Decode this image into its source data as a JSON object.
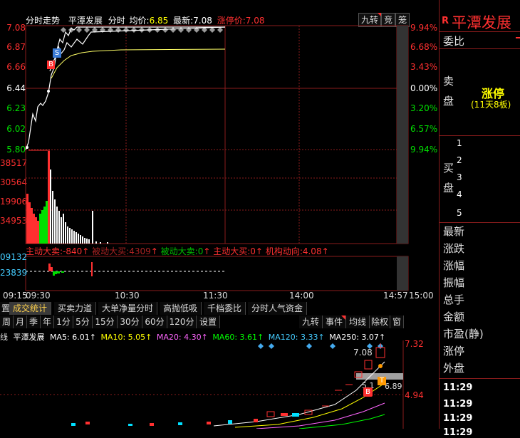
{
  "header": {
    "tab_label": "分时走势",
    "stock_name": "平潭发展",
    "period": "分时",
    "avg_label": "均价:",
    "avg_value": "6.85",
    "last_label": "最新:",
    "last_value": "7.08",
    "limit_label": "涨停价:",
    "limit_value": "7.08",
    "btn_jiuzhuan": "九转",
    "btn_jing": "竞",
    "btn_long": "笼"
  },
  "price_axis_left": [
    "7.08",
    "6.87",
    "6.66",
    "6.44",
    "6.23",
    "6.02",
    "5.80"
  ],
  "price_axis_right": [
    "9.94%",
    "6.68%",
    "3.43%",
    "0.00%",
    "3.20%",
    "6.57%",
    "9.94%"
  ],
  "volume_axis": [
    "38517",
    "30564",
    "19906",
    "34953"
  ],
  "flow": {
    "main_sell_label": "主动大卖:",
    "main_sell_value": "-840",
    "passive_buy_label": "被动大买:",
    "passive_buy_value": "4309",
    "passive_sell_label": "被动大卖:",
    "passive_sell_value": "0",
    "main_buy_label": "主动大买:",
    "main_buy_value": "0",
    "inst_label": "机构动向:",
    "inst_value": "4.08",
    "axis": [
      "09132",
      "23839"
    ]
  },
  "time_axis": [
    "09:15",
    "09:30",
    "10:30",
    "11:30",
    "14:00",
    "14:57",
    "15:00"
  ],
  "markers": {
    "s": "S",
    "b": "B",
    "b2": "B",
    "t": "T"
  },
  "bottom_tabs": [
    "置",
    "成交统计",
    "买卖力道",
    "大单净量分时",
    "高抛低吸",
    "千档委比",
    "分时人气资金"
  ],
  "period_tabs": [
    "周",
    "月",
    "季",
    "年",
    "1分",
    "5分",
    "15分",
    "30分",
    "60分",
    "120分",
    "设置",
    "九转",
    "事件",
    "均线",
    "除权",
    "窗"
  ],
  "ma_line": {
    "prefix": "线",
    "name": "平潭发展",
    "items": [
      {
        "label": "MA5: 6.01↑",
        "color": "#ffffff"
      },
      {
        "label": "MA10: 5.05↑",
        "color": "#ffff00"
      },
      {
        "label": "MA20: 4.30↑",
        "color": "#ff66ff"
      },
      {
        "label": "MA60: 3.61↑",
        "color": "#00ff00"
      },
      {
        "label": "MA120: 3.33↑",
        "color": "#44ccff"
      },
      {
        "label": "MA250: 3.07↑",
        "color": "#ffffff"
      }
    ]
  },
  "kline": {
    "high_label": "7.08",
    "price_high": "7.32",
    "price_low": "4.94",
    "low_label": "5.1",
    "mid_label": "6.89"
  },
  "right_panel": {
    "badge": "R",
    "title": "平潭发展",
    "weibi": "委比",
    "sell_label": "卖盘",
    "limit_text": "涨停",
    "limit_sub": "(11天8板)",
    "buy_label": "买盘",
    "buy_levels": [
      "1",
      "2",
      "3",
      "4",
      "5"
    ],
    "stats": [
      "最新",
      "涨跌",
      "涨幅",
      "振幅",
      "总手",
      "金额",
      "市盈(静)",
      "涨停",
      "外盘"
    ],
    "times": [
      "11:29",
      "11:29",
      "11:29",
      "11:29"
    ]
  },
  "colors": {
    "up": "#ff3030",
    "down": "#00e000",
    "bg": "#000000",
    "grid": "#8a1c1c"
  }
}
